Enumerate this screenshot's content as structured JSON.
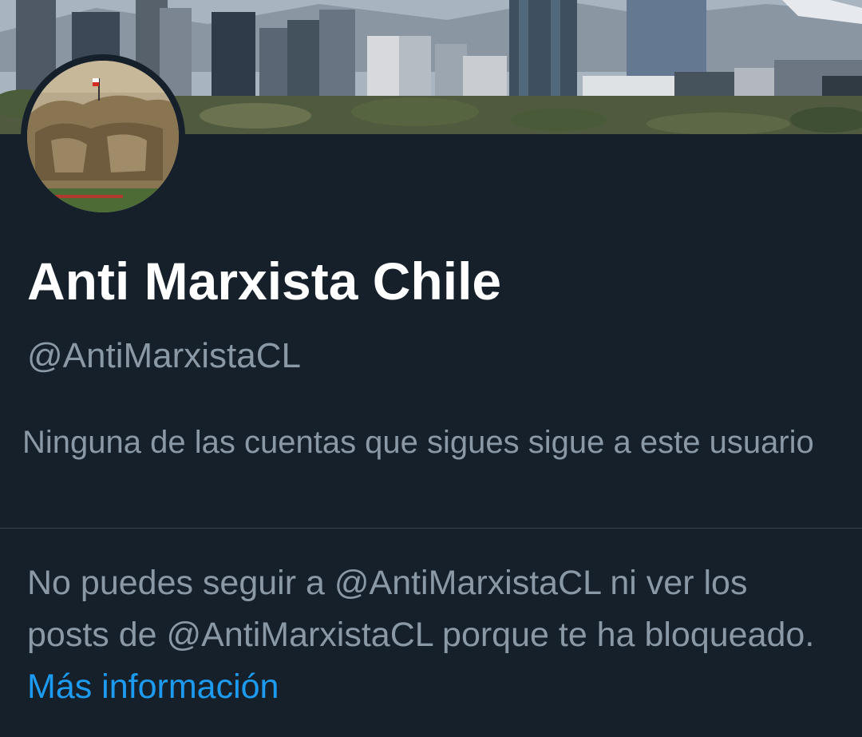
{
  "profile": {
    "display_name": "Anti Marxista Chile",
    "handle": "@AntiMarxistaCL",
    "follow_info": "Ninguna de las cuentas que sigues sigue a este usuario"
  },
  "blocked_notice": {
    "text": "No puedes seguir a @AntiMarxistaCL ni ver los posts de @AntiMarxistaCL porque te ha bloqueado.",
    "link_label": "Más información"
  },
  "colors": {
    "background": "#15202b",
    "primary_text": "#ffffff",
    "secondary_text": "#8b98a5",
    "link": "#1d9bf0",
    "divider": "#38444d"
  }
}
